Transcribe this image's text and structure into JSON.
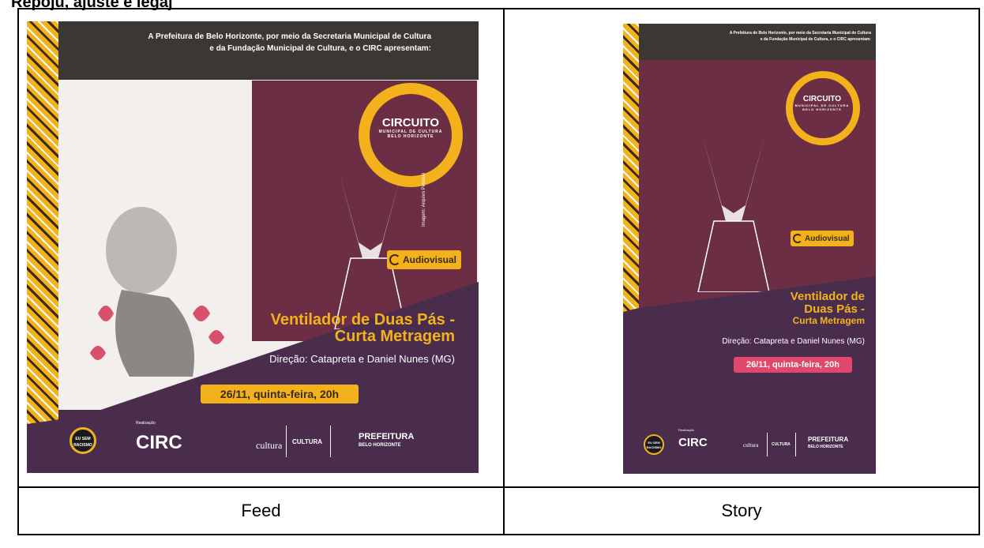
{
  "heading": "Repoju, ajuste e legaj",
  "posters": {
    "feed": {
      "intro_line1": "A Prefeitura de Belo Horizonte, por meio da Secretaria Municipal de Cultura",
      "intro_line2": "e da Fundação Municipal de Cultura, e o CIRC apresentam:",
      "circuito": "CIRCUITO",
      "circuito_sub1": "MUNICIPAL DE CULTURA",
      "circuito_sub2": "BELO HORIZONTE",
      "image_credit": "Imagem: Arquivo Pessoal",
      "category": "Audiovisual",
      "title_line1": "Ventilador de Duas Pás -",
      "title_line2": "Curta Metragem",
      "direction": "Direção: Catapreta e Daniel Nunes (MG)",
      "date": "26/11, quinta-feira, 20h",
      "realizacao": "Realização",
      "circ_logo": "CIRC",
      "badge": "EU SEM RACISMO",
      "fundacao": "cultura",
      "cultura": "CULTURA",
      "prefeitura": "PREFEITURA",
      "prefeitura_sub": "BELO HORIZONTE"
    },
    "story": {
      "intro_line1": "A Prefeitura de Belo Horizonte, por meio da Secretaria Municipal de Cultura",
      "intro_line2": "e da Fundação Municipal de Cultura, e o CIRC apresentam:",
      "circuito": "CIRCUITO",
      "circuito_sub1": "MUNICIPAL DE CULTURA",
      "circuito_sub2": "BELO HORIZONTE",
      "category": "Audiovisual",
      "title_line1": "Ventilador de",
      "title_line2": "Duas Pás -",
      "title_line3": "Curta Metragem",
      "direction": "Direção: Catapreta e Daniel Nunes (MG)",
      "date": "26/11, quinta-feira, 20h",
      "realizacao": "Realização",
      "circ_logo": "CIRC",
      "badge": "EU SEM RACISMO",
      "fundacao": "cultura",
      "cultura": "CULTURA",
      "prefeitura": "PREFEITURA",
      "prefeitura_sub": "BELO HORIZONTE"
    }
  },
  "captions": {
    "feed": "Feed",
    "story": "Story"
  },
  "colors": {
    "accent_yellow": "#f3b21b",
    "wine": "#6b2e45",
    "footer_purple": "#4a2d4d",
    "date_pink": "#e0476a"
  }
}
